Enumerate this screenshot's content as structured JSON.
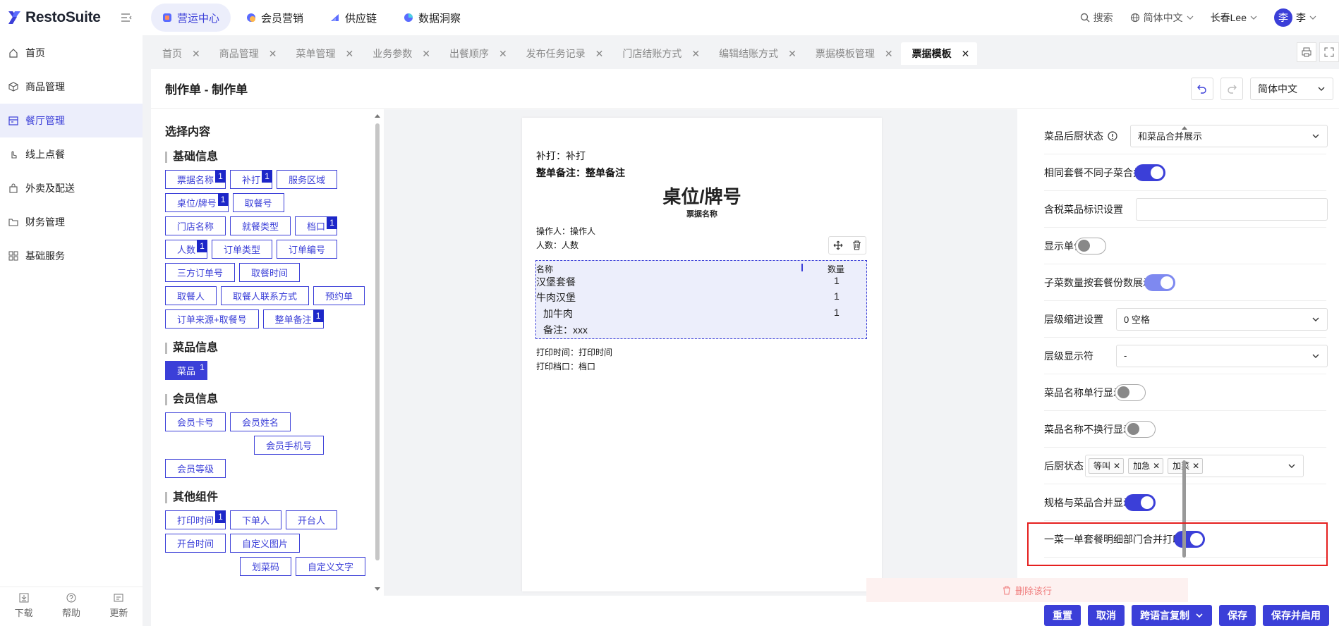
{
  "app": {
    "brand": "RestoSuite"
  },
  "topnav": [
    {
      "label": "营运中心",
      "active": true
    },
    {
      "label": "会员营销"
    },
    {
      "label": "供应链"
    },
    {
      "label": "数据洞察"
    }
  ],
  "topright": {
    "search": "搜索",
    "language": "简体中文",
    "store": "长春Lee",
    "avatar_char": "李",
    "user": "李"
  },
  "sidebar": {
    "items": [
      {
        "label": "首页",
        "icon": "home-icon"
      },
      {
        "label": "商品管理",
        "icon": "box-icon"
      },
      {
        "label": "餐厅管理",
        "icon": "calendar-icon",
        "active": true
      },
      {
        "label": "线上点餐",
        "icon": "hand-icon"
      },
      {
        "label": "外卖及配送",
        "icon": "bag-icon"
      },
      {
        "label": "财务管理",
        "icon": "folder-icon"
      },
      {
        "label": "基础服务",
        "icon": "grid-icon"
      }
    ],
    "bottom": [
      {
        "label": "下载"
      },
      {
        "label": "帮助"
      },
      {
        "label": "更新"
      }
    ]
  },
  "tabs": [
    {
      "label": "首页"
    },
    {
      "label": "商品管理"
    },
    {
      "label": "菜单管理"
    },
    {
      "label": "业务参数"
    },
    {
      "label": "出餐顺序"
    },
    {
      "label": "发布任务记录"
    },
    {
      "label": "门店结账方式"
    },
    {
      "label": "编辑结账方式"
    },
    {
      "label": "票据模板管理"
    },
    {
      "label": "票据模板",
      "active": true
    }
  ],
  "tab_close": "✕",
  "header": {
    "title": "制作单 - 制作单",
    "language": "简体中文"
  },
  "leftpanel": {
    "title": "选择内容",
    "sections": [
      {
        "title": "基础信息",
        "chips": [
          {
            "label": "票据名称",
            "badge": "1"
          },
          {
            "label": "补打",
            "badge": "1"
          },
          {
            "label": "服务区域"
          },
          {
            "label": "桌位/牌号",
            "badge": "1"
          },
          {
            "label": "取餐号"
          },
          {
            "label": "门店名称"
          },
          {
            "label": "就餐类型"
          },
          {
            "label": "档口",
            "badge": "1"
          },
          {
            "label": "人数",
            "badge": "1"
          },
          {
            "label": "订单类型"
          },
          {
            "label": "订单编号"
          },
          {
            "label": "三方订单号"
          },
          {
            "label": "取餐时间"
          },
          {
            "label": "取餐人"
          },
          {
            "label": "取餐人联系方式"
          },
          {
            "label": "预约单"
          },
          {
            "label": "订单来源+取餐号"
          },
          {
            "label": "整单备注",
            "badge": "1"
          }
        ]
      },
      {
        "title": "菜品信息",
        "chips": [
          {
            "label": "菜品",
            "badge": "1",
            "filled": true
          }
        ]
      },
      {
        "title": "会员信息",
        "chips": [
          {
            "label": "会员卡号"
          },
          {
            "label": "会员姓名"
          },
          {
            "label": "会员手机号"
          },
          {
            "label": "会员等级"
          }
        ]
      },
      {
        "title": "其他组件",
        "chips": [
          {
            "label": "打印时间",
            "badge": "1"
          },
          {
            "label": "下单人"
          },
          {
            "label": "开台人"
          },
          {
            "label": "开台时间"
          },
          {
            "label": "自定义图片"
          },
          {
            "label": "划菜码"
          },
          {
            "label": "自定义文字"
          }
        ]
      }
    ]
  },
  "receipt": {
    "reprint": "补打：补打",
    "note": "整单备注：整单备注",
    "table": "桌位/牌号",
    "ticket_name": "票据名称",
    "operator": "操作人：操作人",
    "people": "人数：人数",
    "col_name": "名称",
    "col_qty": "数量",
    "rows": [
      {
        "name": "汉堡套餐",
        "qty": "1"
      },
      {
        "name": "牛肉汉堡",
        "qty": "1"
      },
      {
        "name": "加牛肉",
        "qty": "1"
      },
      {
        "name": "备注：xxx",
        "qty": ""
      }
    ],
    "print_time": "打印时间：打印时间",
    "print_stall": "打印档口：档口"
  },
  "props": [
    {
      "label": "菜品后厨状态",
      "type": "select",
      "value": "和菜品合并展示",
      "info": true
    },
    {
      "label": "相同套餐不同子菜合并",
      "type": "toggle",
      "on": true
    },
    {
      "label": "含税菜品标识设置",
      "type": "input",
      "value": ""
    },
    {
      "label": "显示单位",
      "type": "toggle",
      "on": false
    },
    {
      "label": "子菜数量按套餐份数展示",
      "type": "toggle",
      "on": true,
      "light": true
    },
    {
      "label": "层级缩进设置",
      "type": "select",
      "value": "0 空格"
    },
    {
      "label": "层级显示符",
      "type": "select",
      "value": "-"
    },
    {
      "label": "菜品名称单行显示",
      "type": "toggle",
      "on": false
    },
    {
      "label": "菜品名称不换行显示",
      "type": "toggle",
      "on": false
    },
    {
      "label": "后厨状态",
      "type": "tags",
      "tags": [
        "等叫",
        "加急",
        "加菜"
      ]
    },
    {
      "label": "规格与菜品合并显示",
      "type": "toggle",
      "on": true
    },
    {
      "label": "一菜一单套餐明细部门合并打印",
      "type": "toggle",
      "on": true
    }
  ],
  "delete_row": "删除该行",
  "footer": {
    "reset": "重置",
    "cancel": "取消",
    "copy": "跨语言复制",
    "save": "保存",
    "save_enable": "保存并启用"
  }
}
